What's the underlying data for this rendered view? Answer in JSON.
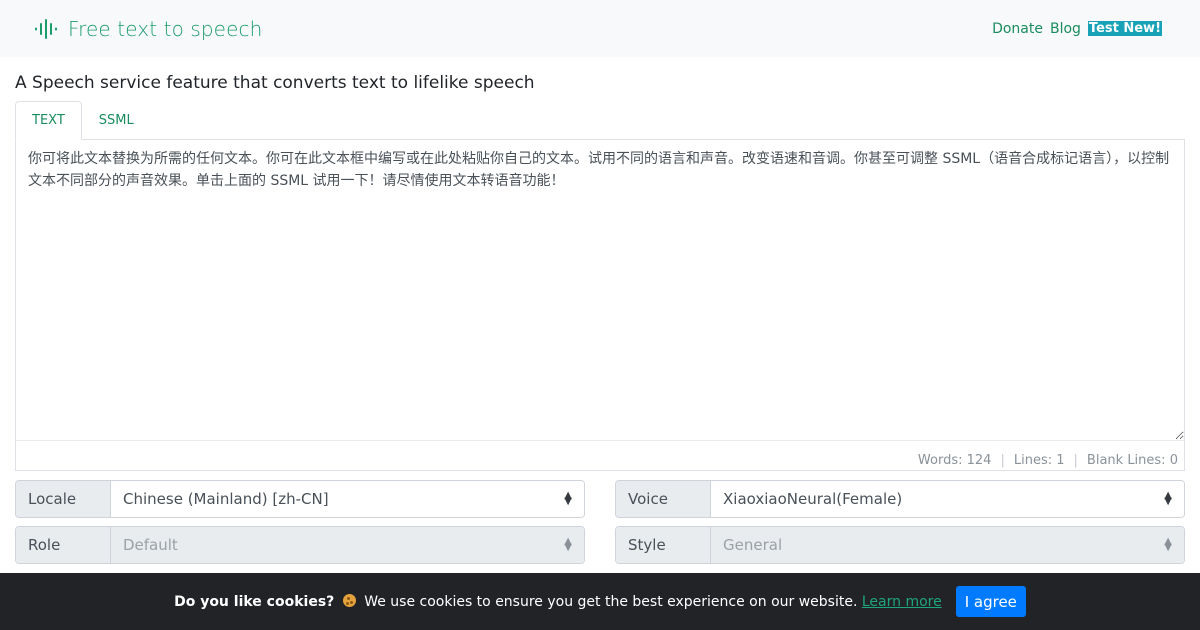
{
  "navbar": {
    "brand": "Free text to speech",
    "links": [
      {
        "label": "Donate"
      },
      {
        "label": "Blog"
      }
    ],
    "badge": "Test New!"
  },
  "headline": "A Speech service feature that converts text to lifelike speech",
  "tabs": [
    {
      "label": "TEXT",
      "active": true
    },
    {
      "label": "SSML",
      "active": false
    }
  ],
  "editor": {
    "text": "你可将此文本替换为所需的任何文本。你可在此文本框中编写或在此处粘贴你自己的文本。试用不同的语言和声音。改变语速和音调。你甚至可调整 SSML（语音合成标记语言），以控制文本不同部分的声音效果。单击上面的 SSML 试用一下！请尽情使用文本转语音功能！",
    "stats": {
      "words_label": "Words:",
      "words": "124",
      "lines_label": "Lines:",
      "lines": "1",
      "blank_label": "Blank Lines:",
      "blank": "0"
    }
  },
  "selects": {
    "locale": {
      "label": "Locale",
      "value": "Chinese (Mainland) [zh-CN]"
    },
    "voice": {
      "label": "Voice",
      "value": "XiaoxiaoNeural(Female)"
    },
    "role": {
      "label": "Role",
      "value": "Default"
    },
    "style": {
      "label": "Style",
      "value": "General"
    }
  },
  "cookie": {
    "title": "Do you like cookies?",
    "message": "We use cookies to ensure you get the best experience on our website.",
    "learn_more": "Learn more",
    "agree": "I agree"
  },
  "colors": {
    "brand": "#1a9c6b",
    "badge": "#17a2b8",
    "agree": "#007bff",
    "cookie_bg": "#212327"
  }
}
